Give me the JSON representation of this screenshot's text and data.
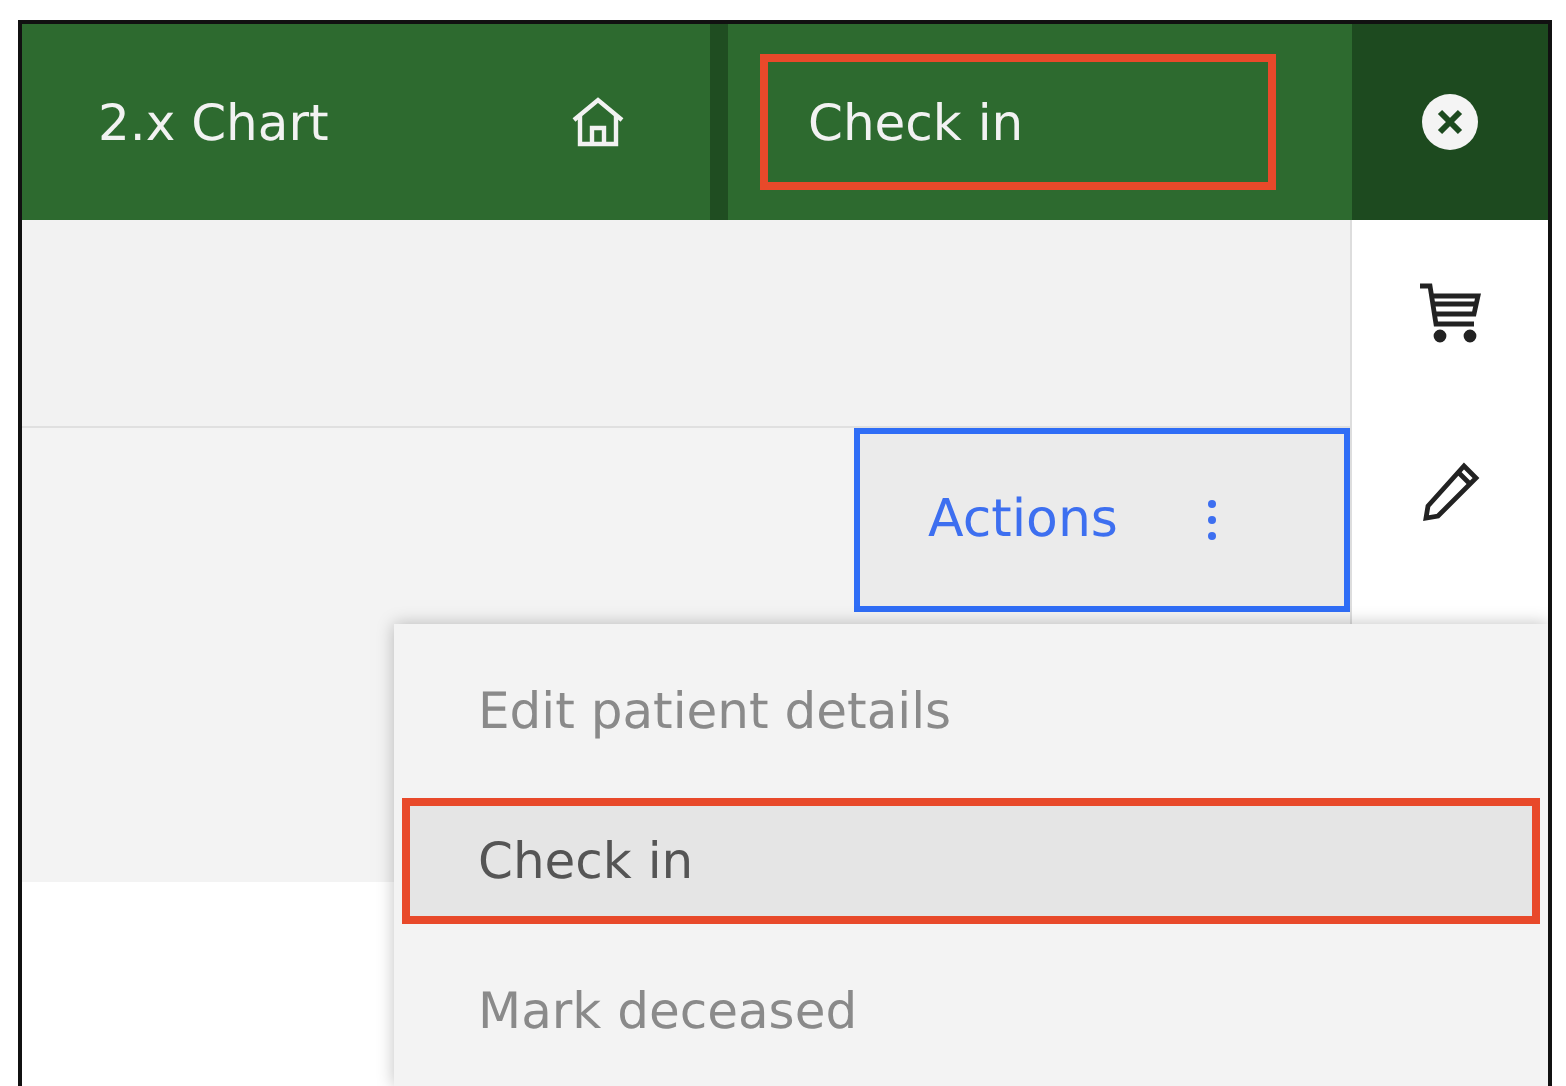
{
  "header": {
    "title": "2.x Chart",
    "current_page": {
      "label": "Check in",
      "highlighted": true
    }
  },
  "actions_button": {
    "label": "Actions",
    "focused": true
  },
  "menu": {
    "items": [
      {
        "label": "Edit patient details",
        "selected": false,
        "highlighted": false
      },
      {
        "label": "Check in",
        "selected": true,
        "highlighted": true
      },
      {
        "label": "Mark deceased",
        "selected": false,
        "highlighted": false
      }
    ]
  }
}
